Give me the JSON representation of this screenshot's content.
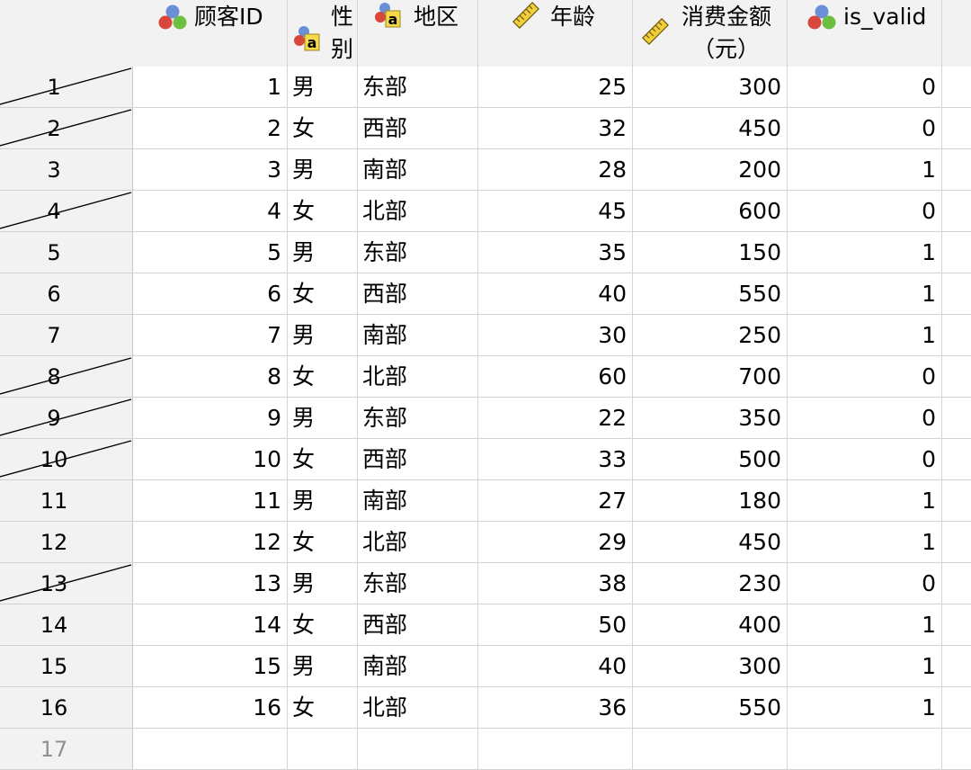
{
  "columns": [
    {
      "key": "id",
      "label": "顾客ID",
      "icon": "nominal-icon"
    },
    {
      "key": "gender",
      "label_line1": "性",
      "label_line2": "别",
      "icon": "string-nominal-icon"
    },
    {
      "key": "region",
      "label": "地区",
      "icon": "string-nominal-icon"
    },
    {
      "key": "age",
      "label": "年龄",
      "icon": "scale-icon"
    },
    {
      "key": "amount",
      "label_line1": "消费金额",
      "label_line2": "（元）",
      "icon": "scale-icon"
    },
    {
      "key": "is_valid",
      "label": "is_valid",
      "icon": "nominal-icon"
    }
  ],
  "rows": [
    {
      "n": "1",
      "id": "1",
      "gender": "男",
      "region": "东部",
      "age": "25",
      "amount": "300",
      "is_valid": "0",
      "filtered": true
    },
    {
      "n": "2",
      "id": "2",
      "gender": "女",
      "region": "西部",
      "age": "32",
      "amount": "450",
      "is_valid": "0",
      "filtered": true
    },
    {
      "n": "3",
      "id": "3",
      "gender": "男",
      "region": "南部",
      "age": "28",
      "amount": "200",
      "is_valid": "1",
      "filtered": false
    },
    {
      "n": "4",
      "id": "4",
      "gender": "女",
      "region": "北部",
      "age": "45",
      "amount": "600",
      "is_valid": "0",
      "filtered": true
    },
    {
      "n": "5",
      "id": "5",
      "gender": "男",
      "region": "东部",
      "age": "35",
      "amount": "150",
      "is_valid": "1",
      "filtered": false
    },
    {
      "n": "6",
      "id": "6",
      "gender": "女",
      "region": "西部",
      "age": "40",
      "amount": "550",
      "is_valid": "1",
      "filtered": false
    },
    {
      "n": "7",
      "id": "7",
      "gender": "男",
      "region": "南部",
      "age": "30",
      "amount": "250",
      "is_valid": "1",
      "filtered": false
    },
    {
      "n": "8",
      "id": "8",
      "gender": "女",
      "region": "北部",
      "age": "60",
      "amount": "700",
      "is_valid": "0",
      "filtered": true
    },
    {
      "n": "9",
      "id": "9",
      "gender": "男",
      "region": "东部",
      "age": "22",
      "amount": "350",
      "is_valid": "0",
      "filtered": true
    },
    {
      "n": "10",
      "id": "10",
      "gender": "女",
      "region": "西部",
      "age": "33",
      "amount": "500",
      "is_valid": "0",
      "filtered": true
    },
    {
      "n": "11",
      "id": "11",
      "gender": "男",
      "region": "南部",
      "age": "27",
      "amount": "180",
      "is_valid": "1",
      "filtered": false
    },
    {
      "n": "12",
      "id": "12",
      "gender": "女",
      "region": "北部",
      "age": "29",
      "amount": "450",
      "is_valid": "1",
      "filtered": false
    },
    {
      "n": "13",
      "id": "13",
      "gender": "男",
      "region": "东部",
      "age": "38",
      "amount": "230",
      "is_valid": "0",
      "filtered": true
    },
    {
      "n": "14",
      "id": "14",
      "gender": "女",
      "region": "西部",
      "age": "50",
      "amount": "400",
      "is_valid": "1",
      "filtered": false
    },
    {
      "n": "15",
      "id": "15",
      "gender": "男",
      "region": "南部",
      "age": "40",
      "amount": "300",
      "is_valid": "1",
      "filtered": false
    },
    {
      "n": "16",
      "id": "16",
      "gender": "女",
      "region": "北部",
      "age": "36",
      "amount": "550",
      "is_valid": "1",
      "filtered": false
    },
    {
      "n": "17",
      "id": "",
      "gender": "",
      "region": "",
      "age": "",
      "amount": "",
      "is_valid": "",
      "filtered": false,
      "empty": true
    }
  ],
  "colors": {
    "header_bg": "#f2f2f2",
    "gridline": "#d4d4d4",
    "empty_row_number": "#909090"
  }
}
